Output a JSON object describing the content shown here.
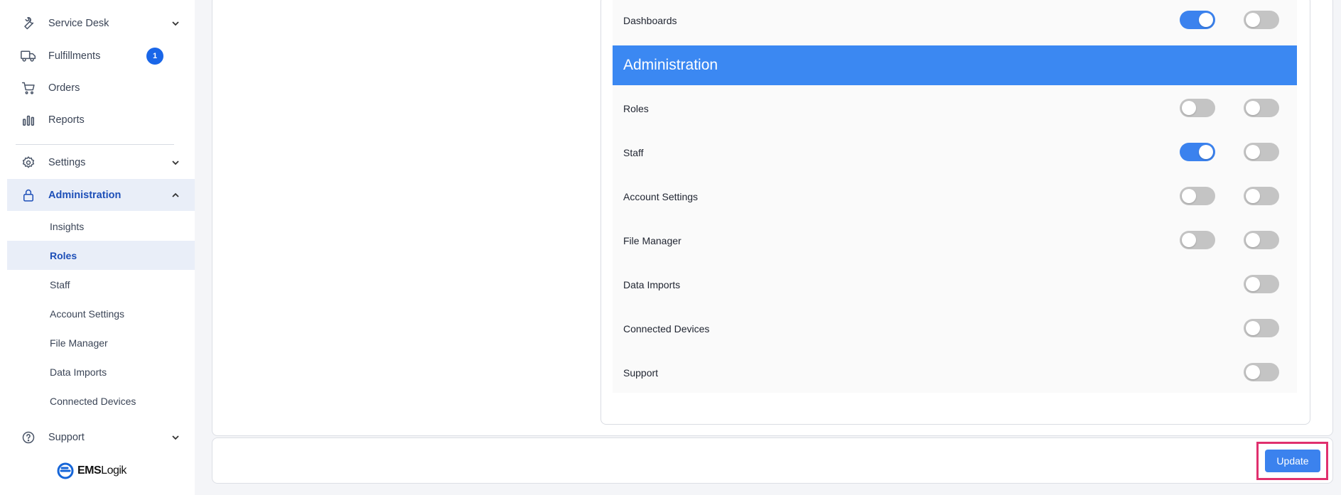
{
  "sidebar": {
    "items": [
      {
        "label": "Service Desk",
        "icon": "wrench-icon"
      },
      {
        "label": "Fulfillments",
        "icon": "truck-icon",
        "badge": "1"
      },
      {
        "label": "Orders",
        "icon": "cart-icon"
      },
      {
        "label": "Reports",
        "icon": "bar-chart-icon"
      },
      {
        "label": "Settings",
        "icon": "gear-icon"
      },
      {
        "label": "Administration",
        "icon": "lock-icon"
      }
    ],
    "admin_subitems": [
      {
        "label": "Insights"
      },
      {
        "label": "Roles"
      },
      {
        "label": "Staff"
      },
      {
        "label": "Account Settings"
      },
      {
        "label": "File Manager"
      },
      {
        "label": "Data Imports"
      },
      {
        "label": "Connected Devices"
      }
    ],
    "support": {
      "label": "Support",
      "icon": "help-circle-icon"
    },
    "logo": {
      "brand": "EMS",
      "suffix": "Logik"
    }
  },
  "permissions": {
    "dashboards_row": {
      "label": "Dashboards",
      "col1": true,
      "col2": false
    },
    "section_title": "Administration",
    "rows": [
      {
        "label": "Roles",
        "col1": false,
        "col2": false
      },
      {
        "label": "Staff",
        "col1": true,
        "col2": false
      },
      {
        "label": "Account Settings",
        "col1": false,
        "col2": false
      },
      {
        "label": "File Manager",
        "col1": false,
        "col2": false
      },
      {
        "label": "Data Imports",
        "col1": null,
        "col2": false
      },
      {
        "label": "Connected Devices",
        "col1": null,
        "col2": false
      },
      {
        "label": "Support",
        "col1": null,
        "col2": false
      }
    ]
  },
  "footer": {
    "update_label": "Update"
  },
  "colors": {
    "accent": "#3b88f2",
    "toggle_on": "#3b82ee",
    "toggle_off": "#c4c4c4",
    "highlight": "#e0306e"
  }
}
